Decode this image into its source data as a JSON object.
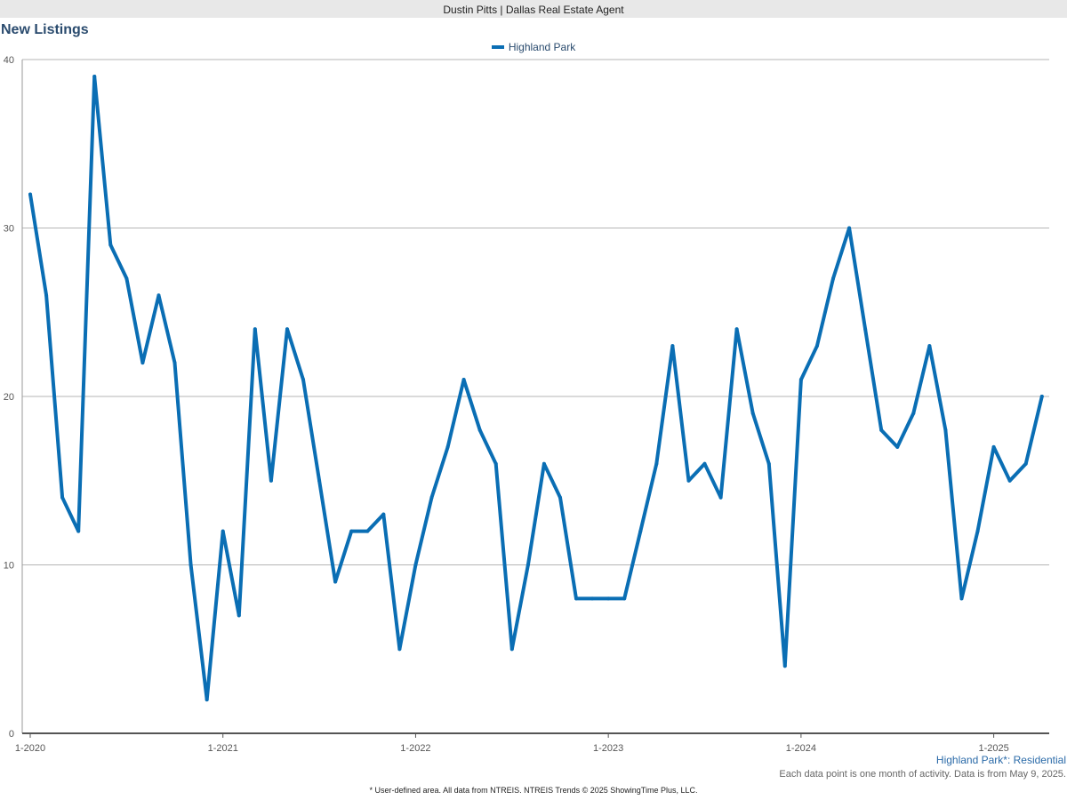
{
  "header": {
    "agent": "Dustin Pitts | Dallas Real Estate Agent"
  },
  "chart_data": {
    "type": "line",
    "title": "New Listings",
    "xlabel": "",
    "ylabel": "",
    "ylim": [
      0,
      40
    ],
    "yticks": [
      0,
      10,
      20,
      30,
      40
    ],
    "grid": true,
    "legend_position": "top-center",
    "x_tick_labels": [
      "1-2020",
      "1-2021",
      "1-2022",
      "1-2023",
      "1-2024",
      "1-2025"
    ],
    "x": [
      "1-2020",
      "2-2020",
      "3-2020",
      "4-2020",
      "5-2020",
      "6-2020",
      "7-2020",
      "8-2020",
      "9-2020",
      "10-2020",
      "11-2020",
      "12-2020",
      "1-2021",
      "2-2021",
      "3-2021",
      "4-2021",
      "5-2021",
      "6-2021",
      "7-2021",
      "8-2021",
      "9-2021",
      "10-2021",
      "11-2021",
      "12-2021",
      "1-2022",
      "2-2022",
      "3-2022",
      "4-2022",
      "5-2022",
      "6-2022",
      "7-2022",
      "8-2022",
      "9-2022",
      "10-2022",
      "11-2022",
      "12-2022",
      "1-2023",
      "2-2023",
      "3-2023",
      "4-2023",
      "5-2023",
      "6-2023",
      "7-2023",
      "8-2023",
      "9-2023",
      "10-2023",
      "11-2023",
      "12-2023",
      "1-2024",
      "2-2024",
      "3-2024",
      "4-2024",
      "5-2024",
      "6-2024",
      "7-2024",
      "8-2024",
      "9-2024",
      "10-2024",
      "11-2024",
      "12-2024",
      "1-2025",
      "2-2025",
      "3-2025",
      "4-2025"
    ],
    "series": [
      {
        "name": "Highland Park",
        "color": "#0a6eb4",
        "values": [
          32,
          26,
          14,
          12,
          39,
          29,
          27,
          22,
          26,
          22,
          10,
          2,
          12,
          7,
          24,
          15,
          24,
          21,
          15,
          9,
          12,
          12,
          13,
          5,
          10,
          14,
          17,
          21,
          18,
          16,
          5,
          10,
          16,
          14,
          8,
          8,
          8,
          8,
          12,
          16,
          23,
          15,
          16,
          14,
          24,
          19,
          16,
          4,
          21,
          23,
          27,
          30,
          24,
          18,
          17,
          19,
          23,
          18,
          8,
          12,
          17,
          15,
          16,
          20
        ]
      }
    ]
  },
  "footer": {
    "series_label": "Highland Park*: Residential",
    "note": "Each data point is one month of activity. Data is from May 9, 2025.",
    "disclaimer": "* User-defined area. All data from NTREIS. NTREIS Trends © 2025 ShowingTime Plus, LLC."
  }
}
